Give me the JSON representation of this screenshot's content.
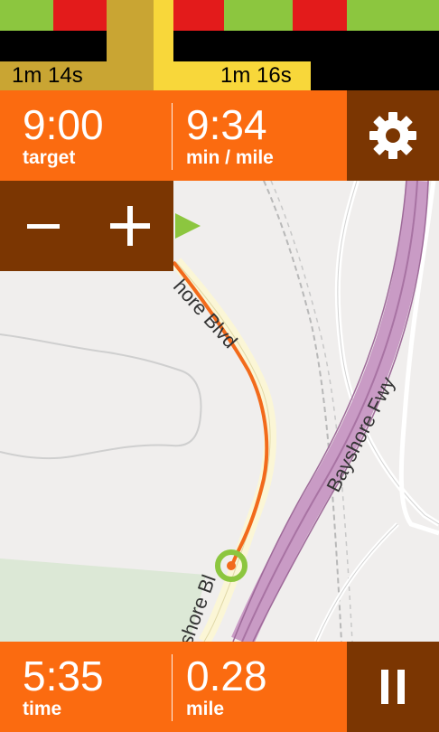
{
  "split_bar": {
    "colors": {
      "green": "#8cc63f",
      "red": "#e31b1b",
      "previous_split": "#c9a533",
      "current_split": "#f8d73a"
    },
    "previous_split_time": "1m 14s",
    "current_split_time": "1m 16s"
  },
  "pace_panel": {
    "target_value": "9:00",
    "target_label": "target",
    "pace_value": "9:34",
    "pace_label": "min / mile"
  },
  "settings": {
    "icon": "gear-icon"
  },
  "zoom": {
    "zoom_out_icon": "minus-icon",
    "zoom_in_icon": "plus-icon"
  },
  "map": {
    "street_label_1": "hore  Blvd",
    "street_label_2": "Bayshore  Fwy",
    "street_label_3": "shore  Bl",
    "route_color": "#f26a1b",
    "highway_color": "#c99bc5"
  },
  "bottom_panel": {
    "time_value": "5:35",
    "time_label": "time",
    "distance_value": "0.28",
    "distance_label": "mile"
  },
  "pause": {
    "icon": "pause-icon"
  },
  "colors": {
    "orange": "#fb6b10",
    "dark_brown": "#7b3602"
  }
}
